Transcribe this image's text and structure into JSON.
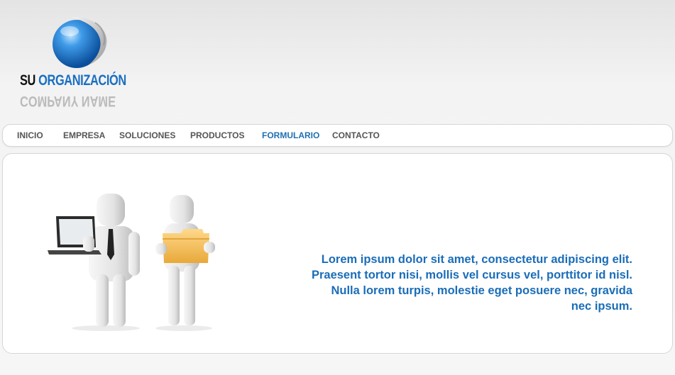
{
  "logo": {
    "word1": "SU",
    "word2": "ORGANIZACIÓN",
    "reflection": "COMPANY NAME",
    "colors": {
      "primary": "#1b6fc2",
      "dark": "#111111"
    }
  },
  "nav": {
    "items": [
      {
        "label": "INICIO",
        "active": false
      },
      {
        "label": "EMPRESA",
        "active": false
      },
      {
        "label": "SOLUCIONES",
        "active": false
      },
      {
        "label": "PRODUCTOS",
        "active": false
      },
      {
        "label": "FORMULARIO",
        "active": true
      },
      {
        "label": "CONTACTO",
        "active": false
      }
    ],
    "active_color": "#1e6fb3"
  },
  "hero": {
    "text": "Lorem ipsum dolor sit amet, consectetur adipiscing elit. Praesent tortor nisi, mollis vel cursus vel, porttitor id nisl. Nulla lorem turpis, molestie eget posuere nec, gravida nec ipsum.",
    "text_color": "#1a6db8",
    "illustration": "two-3d-figures-laptop-folder"
  }
}
